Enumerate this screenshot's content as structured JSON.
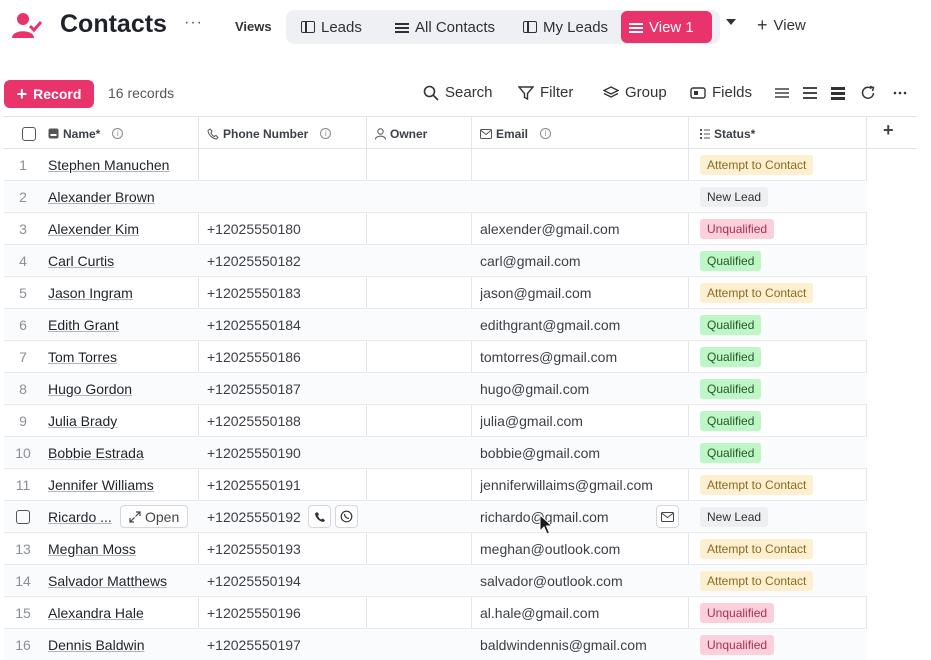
{
  "header": {
    "title": "Contacts",
    "more_glyph": "···",
    "views_label": "Views",
    "tabs": [
      {
        "label": "Leads",
        "icon": "table-icon"
      },
      {
        "label": "All Contacts",
        "icon": "list-icon"
      },
      {
        "label": "My Leads",
        "icon": "table-icon"
      },
      {
        "label": "View 1",
        "icon": "list-icon",
        "active": true
      }
    ],
    "add_view_label": "View"
  },
  "toolbar": {
    "record_label": "Record",
    "record_count": "16 records",
    "search_label": "Search",
    "filter_label": "Filter",
    "group_label": "Group",
    "fields_label": "Fields"
  },
  "columns": {
    "name": "Name*",
    "phone": "Phone Number",
    "owner": "Owner",
    "email": "Email",
    "status": "Status*"
  },
  "colors": {
    "accent": "#e8336b",
    "attempt_bg": "#fdefcf",
    "attempt_fg": "#8a6a1e",
    "new_bg": "#eeeff1",
    "new_fg": "#2c3038",
    "unqualified_bg": "#fbcfdc",
    "unqualified_fg": "#a23358",
    "qualified_bg": "#bff6c5",
    "qualified_fg": "#1e5a29"
  },
  "rows": [
    {
      "num": "1",
      "name": "Stephen Manuchen",
      "phone": "",
      "email": "",
      "status": "Attempt to Contact"
    },
    {
      "num": "2",
      "name": "Alexander Brown",
      "phone": "",
      "email": "",
      "status": "New Lead"
    },
    {
      "num": "3",
      "name": "Alexender Kim",
      "phone": "+12025550180",
      "email": "alexender@gmail.com",
      "status": "Unqualified"
    },
    {
      "num": "4",
      "name": "Carl Curtis",
      "phone": "+12025550182",
      "email": "carl@gmail.com",
      "status": "Qualified"
    },
    {
      "num": "5",
      "name": "Jason Ingram",
      "phone": "+12025550183",
      "email": "jason@gmail.com",
      "status": "Attempt to Contact"
    },
    {
      "num": "6",
      "name": "Edith Grant",
      "phone": "+12025550184",
      "email": "edithgrant@gmail.com",
      "status": "Qualified"
    },
    {
      "num": "7",
      "name": "Tom Torres",
      "phone": "+12025550186",
      "email": "tomtorres@gmail.com",
      "status": "Qualified"
    },
    {
      "num": "8",
      "name": "Hugo Gordon",
      "phone": "+12025550187",
      "email": "hugo@gmail.com",
      "status": "Qualified"
    },
    {
      "num": "9",
      "name": "Julia Brady",
      "phone": "+12025550188",
      "email": "julia@gmail.com",
      "status": "Qualified"
    },
    {
      "num": "10",
      "name": "Bobbie Estrada",
      "phone": "+12025550190",
      "email": "bobbie@gmail.com",
      "status": "Qualified"
    },
    {
      "num": "11",
      "name": "Jennifer Williams",
      "phone": "+12025550191",
      "email": "jenniferwillaims@gmail.com",
      "status": "Attempt to Contact"
    },
    {
      "num": "",
      "name": "Ricardo ...",
      "phone": "+12025550192",
      "email": "richardo@gmail.com",
      "status": "New Lead",
      "hover": true,
      "open_label": "Open"
    },
    {
      "num": "13",
      "name": "Meghan Moss",
      "phone": "+12025550193",
      "email": "meghan@outlook.com",
      "status": "Attempt to Contact"
    },
    {
      "num": "14",
      "name": "Salvador Matthews",
      "phone": "+12025550194",
      "email": "salvador@outlook.com",
      "status": "Attempt to Contact"
    },
    {
      "num": "15",
      "name": "Alexandra Hale",
      "phone": "+12025550196",
      "email": "al.hale@gmail.com",
      "status": "Unqualified"
    },
    {
      "num": "16",
      "name": "Dennis Baldwin",
      "phone": "+12025550197",
      "email": "baldwindennis@gmail.com",
      "status": "Unqualified"
    }
  ]
}
